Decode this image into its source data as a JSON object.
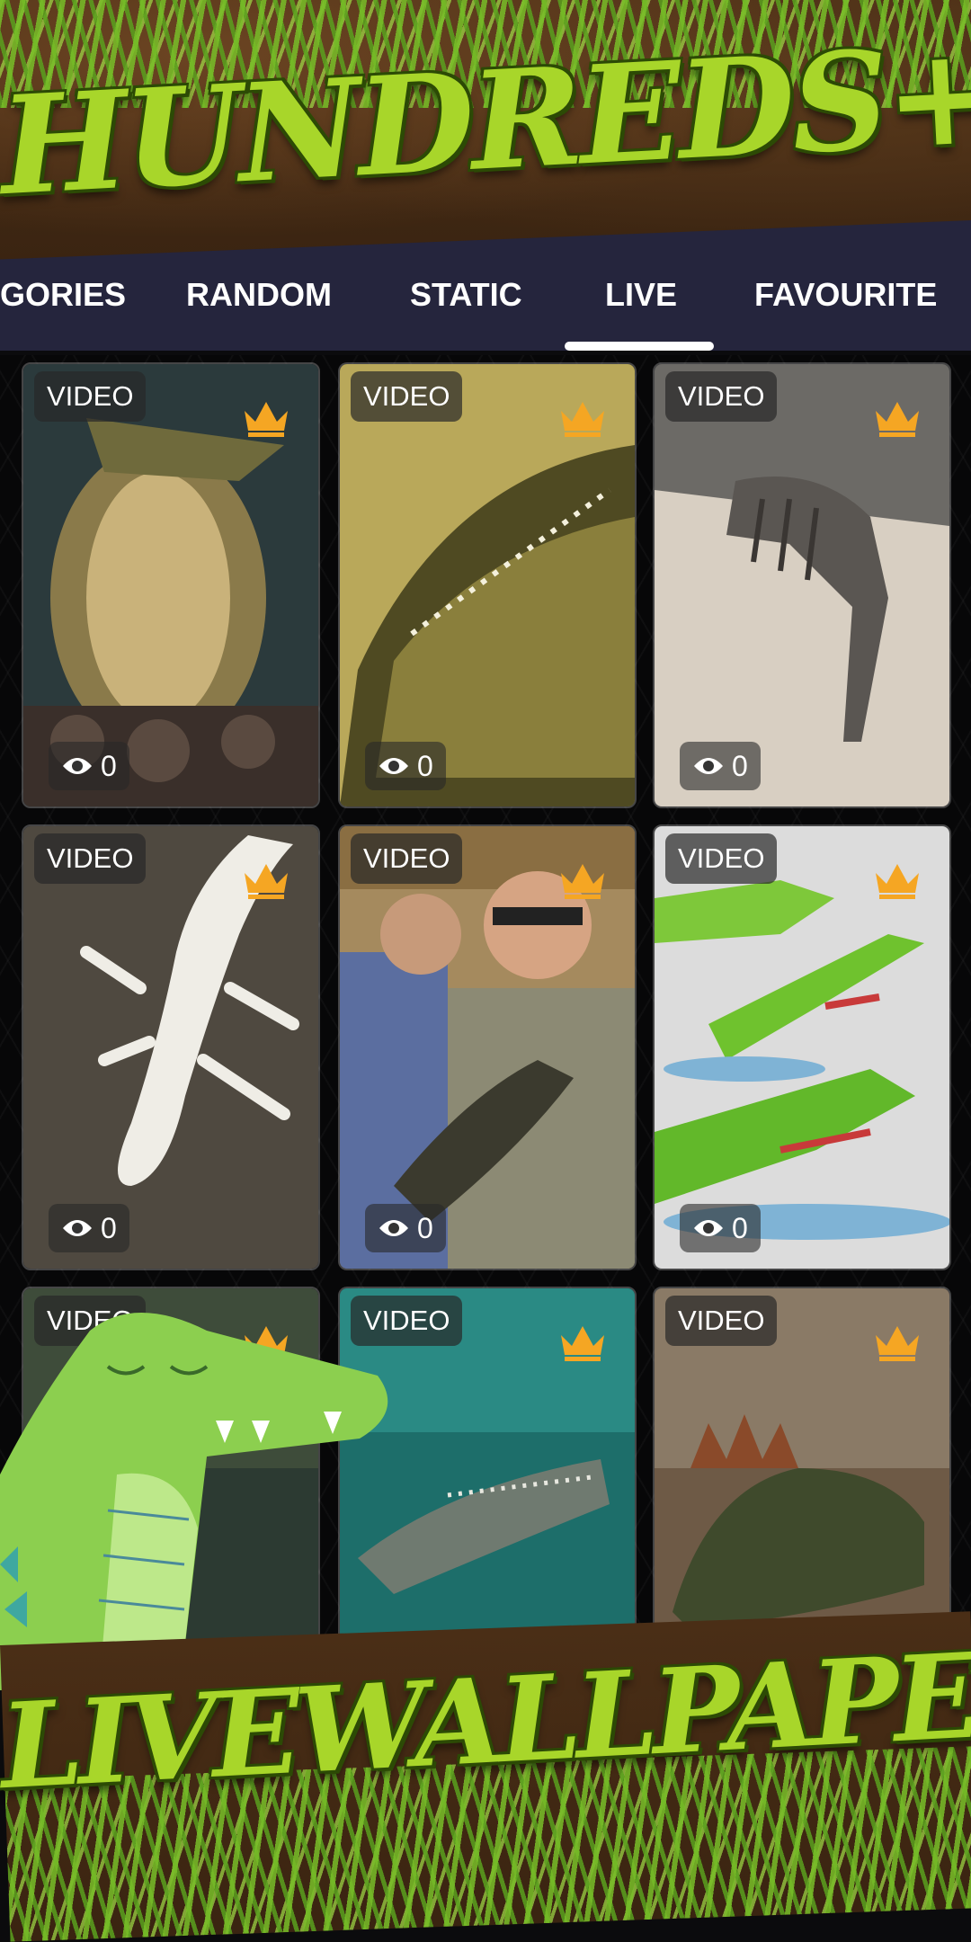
{
  "banner": {
    "top_title": "HUNDREDS+",
    "bottom_title": "LIVEWALLPAPER"
  },
  "tabs": [
    {
      "label": "GORIES"
    },
    {
      "label": "RANDOM"
    },
    {
      "label": "STATIC"
    },
    {
      "label": "LIVE",
      "selected": true
    },
    {
      "label": "FAVOURITE"
    }
  ],
  "cards": [
    {
      "badge": "VIDEO",
      "views": "0",
      "premium_icon": "crown-icon",
      "subject": "monster crocodile on rocks"
    },
    {
      "badge": "VIDEO",
      "views": "0",
      "premium_icon": "crown-icon",
      "subject": "crocodile head sketch"
    },
    {
      "badge": "VIDEO",
      "views": "0",
      "premium_icon": "crown-icon",
      "subject": "crocodile skeleton museum"
    },
    {
      "badge": "VIDEO",
      "views": "0",
      "premium_icon": "crown-icon",
      "subject": "white albino alligator"
    },
    {
      "badge": "VIDEO",
      "views": "0",
      "premium_icon": "crown-icon",
      "subject": "man holding baby alligator"
    },
    {
      "badge": "VIDEO",
      "views": "0",
      "premium_icon": "crown-icon",
      "subject": "stained glass crocodiles"
    },
    {
      "badge": "VIDEO",
      "premium_icon": "crown-icon",
      "subject": "alligator in pond"
    },
    {
      "badge": "VIDEO",
      "premium_icon": "crown-icon",
      "subject": "crocodile underwater"
    },
    {
      "badge": "VIDEO",
      "premium_icon": "crown-icon",
      "subject": "stegosaurus crocodile"
    }
  ],
  "colors": {
    "tab_bar": "#25253d",
    "title_green": "#a8d62a",
    "crown": "#f5a623"
  }
}
